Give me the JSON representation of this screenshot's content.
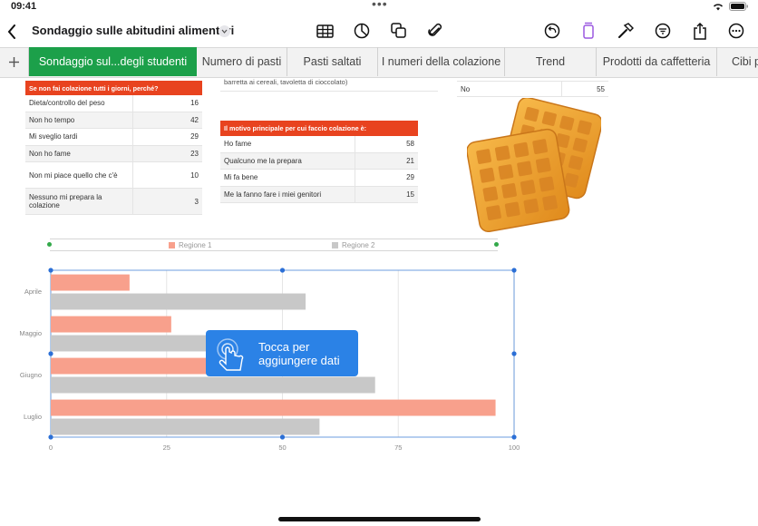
{
  "status": {
    "time": "09:41",
    "dots": "•••"
  },
  "toolbar": {
    "title": "Sondaggio sulle abitudini alimentari"
  },
  "tabs": [
    {
      "label": "Sondaggio sul...degli studenti"
    },
    {
      "label": "Numero di pasti"
    },
    {
      "label": "Pasti saltati"
    },
    {
      "label": "I numeri della colazione"
    },
    {
      "label": "Trend"
    },
    {
      "label": "Prodotti da caffetteria"
    },
    {
      "label": "Cibi p"
    }
  ],
  "partial_table": {
    "text": "barretta ai cereali, tavoletta di cioccolato)"
  },
  "no_table": {
    "label": "No",
    "value": "55"
  },
  "reasons_table": {
    "title": "Se non fai colazione tutti i giorni, perché?",
    "rows": [
      {
        "label": "Dieta/controllo del peso",
        "value": "16"
      },
      {
        "label": "Non ho tempo",
        "value": "42"
      },
      {
        "label": "Mi sveglio tardi",
        "value": "29"
      },
      {
        "label": "Non ho fame",
        "value": "23"
      },
      {
        "label": "Non mi piace quello che c'è",
        "value": "10"
      },
      {
        "label": "Nessuno mi prepara la colazione",
        "value": "3"
      }
    ]
  },
  "motive_table": {
    "title": "Il motivo principale per cui faccio colazione è:",
    "rows": [
      {
        "label": "Ho fame",
        "value": "58"
      },
      {
        "label": "Qualcuno me la prepara",
        "value": "21"
      },
      {
        "label": "Mi fa bene",
        "value": "29"
      },
      {
        "label": "Me la fanno fare i miei genitori",
        "value": "15"
      }
    ]
  },
  "popover": {
    "text": "Tocca per aggiungere dati"
  },
  "chart_data": {
    "type": "bar",
    "orientation": "horizontal",
    "categories": [
      "Aprile",
      "Maggio",
      "Giugno",
      "Luglio"
    ],
    "series": [
      {
        "name": "Regione 1",
        "color": "#f8a08c",
        "values": [
          17,
          26,
          53,
          96
        ]
      },
      {
        "name": "Regione 2",
        "color": "#c8c8c8",
        "values": [
          55,
          38,
          70,
          58
        ]
      }
    ],
    "xlim": [
      0,
      100
    ],
    "xticks": [
      "0",
      "25",
      "50",
      "75",
      "100"
    ],
    "legend_position": "top",
    "grid": true
  }
}
